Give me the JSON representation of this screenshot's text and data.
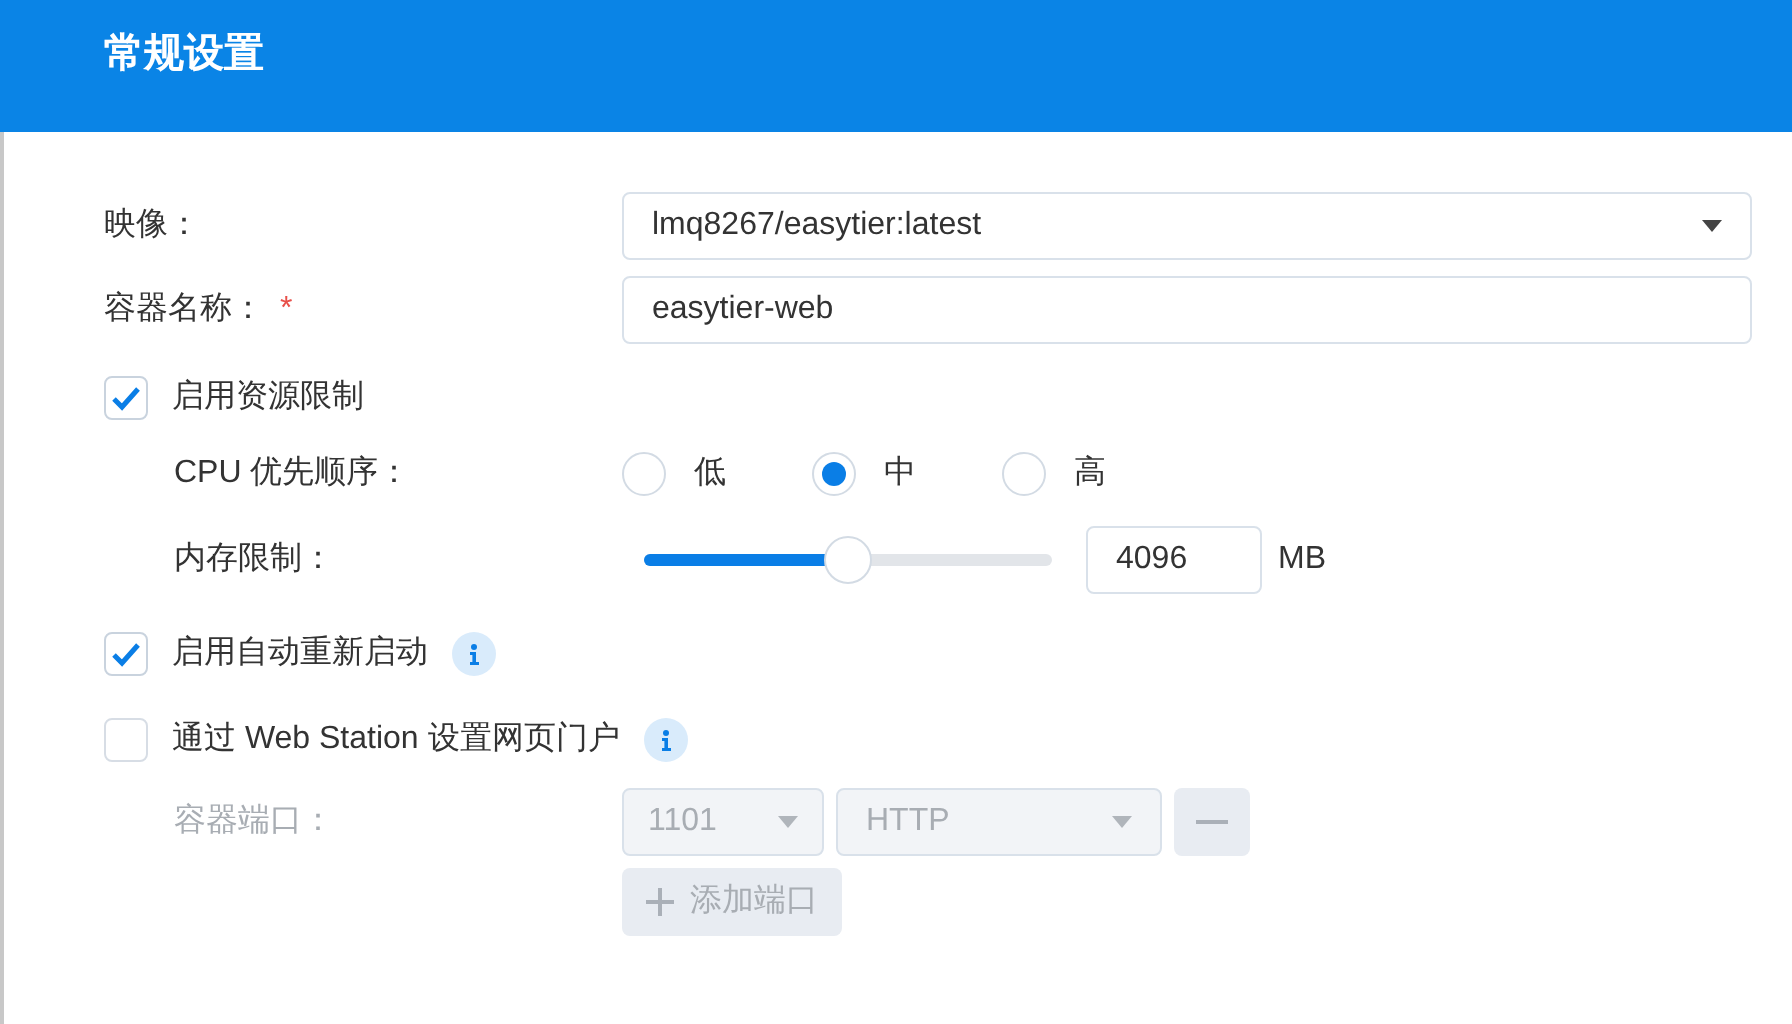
{
  "header": {
    "title": "常规设置"
  },
  "image": {
    "label": "映像：",
    "value": "lmq8267/easytier:latest"
  },
  "container_name": {
    "label": "容器名称：",
    "required_mark": "*",
    "value": "easytier-web"
  },
  "resource_limit": {
    "label": "启用资源限制",
    "checked": true,
    "cpu": {
      "label": "CPU 优先顺序：",
      "options": [
        {
          "label": "低",
          "selected": false
        },
        {
          "label": "中",
          "selected": true
        },
        {
          "label": "高",
          "selected": false
        }
      ]
    },
    "memory": {
      "label": "内存限制：",
      "level": 0.5,
      "value": "4096",
      "unit": "MB"
    }
  },
  "auto_restart": {
    "label": "启用自动重新启动",
    "checked": true
  },
  "web_station": {
    "label": "通过 Web Station 设置网页门户",
    "checked": false,
    "ports": {
      "label": "容器端口：",
      "disabled": true,
      "port": "1101",
      "protocol": "HTTP",
      "add_label": "添加端口"
    }
  }
}
